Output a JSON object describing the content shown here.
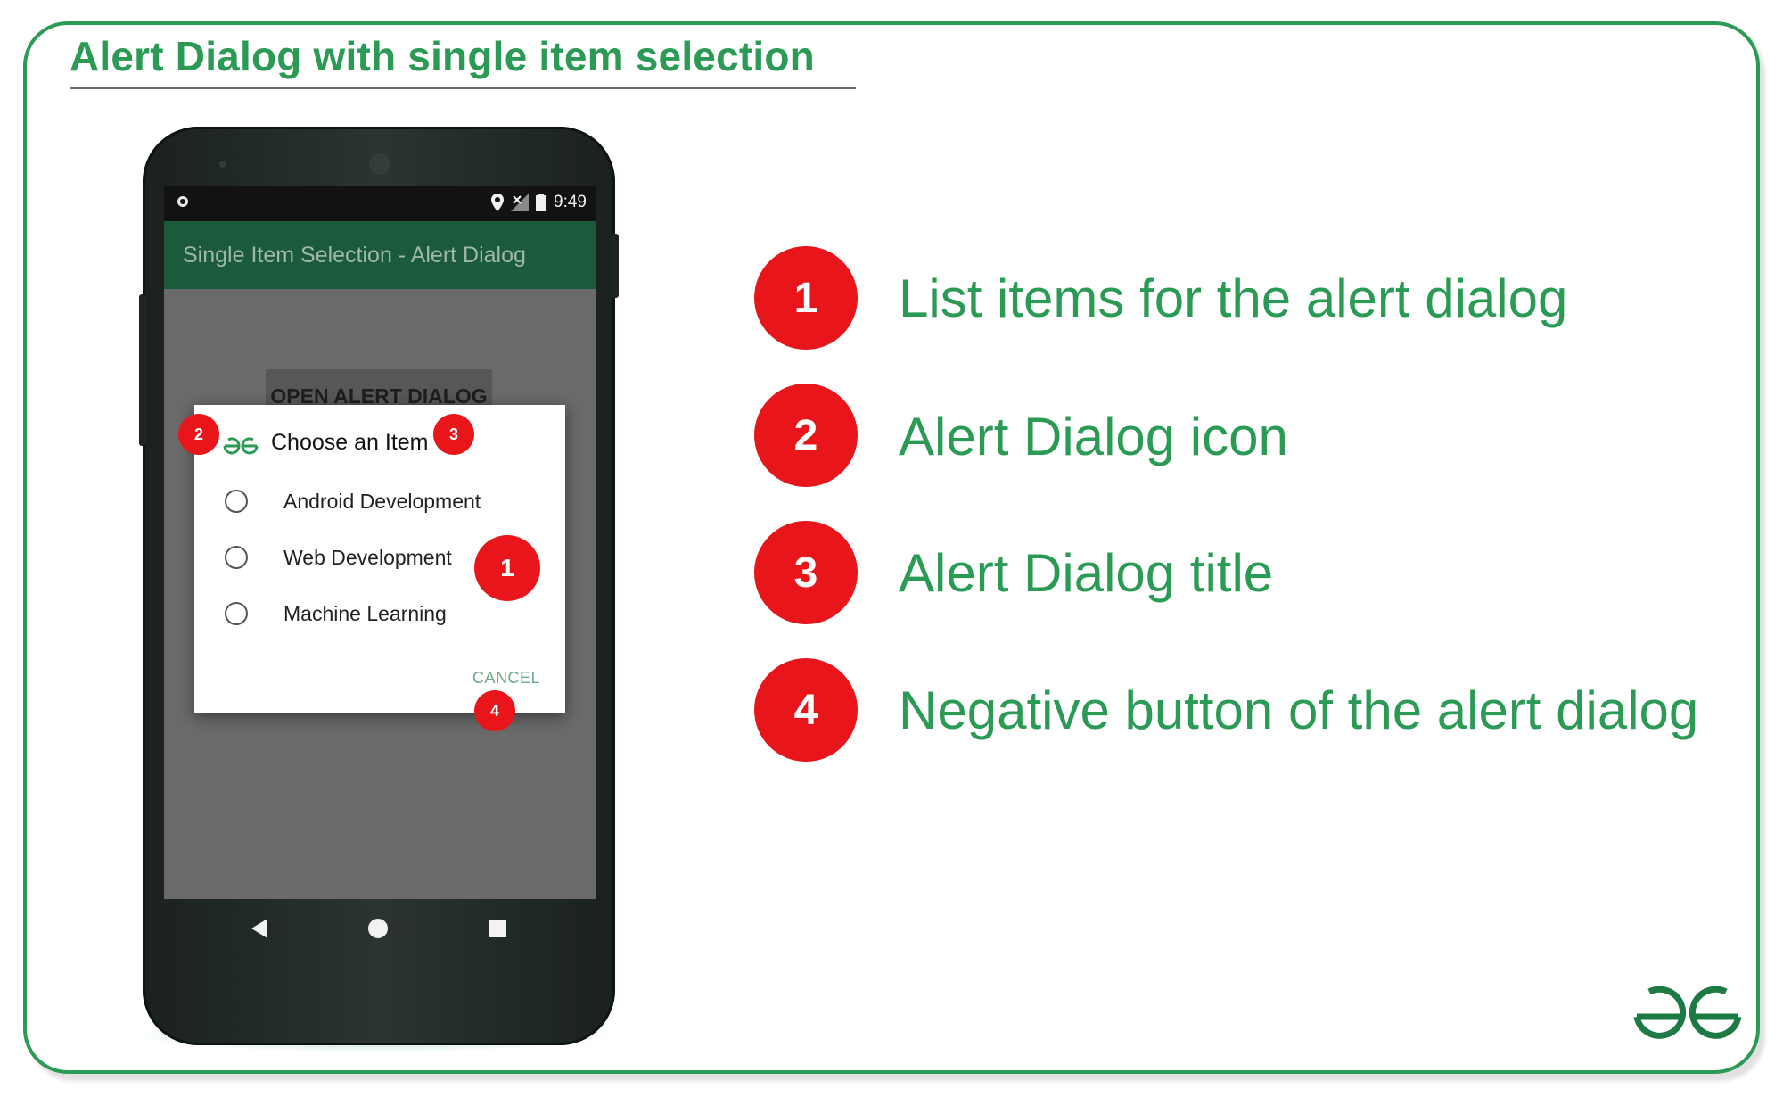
{
  "header": {
    "title": "Alert Dialog with single item selection"
  },
  "colors": {
    "brand_green": "#2a9a55",
    "badge_red": "#e8161b",
    "appbar_green": "#1b5a3a"
  },
  "phone": {
    "status_bar": {
      "time": "9:49",
      "icons": [
        "location-icon",
        "no-signal-icon",
        "battery-icon"
      ]
    },
    "app_bar": {
      "title": "Single Item Selection - Alert Dialog"
    },
    "open_button_label": "OPEN ALERT DIALOG",
    "dialog": {
      "icon": "gfg-logo-icon",
      "title": "Choose an Item",
      "items": [
        "Android Development",
        "Web Development",
        "Machine Learning"
      ],
      "negative_button": "CANCEL"
    },
    "callouts": {
      "items": "1",
      "icon": "2",
      "title": "3",
      "negative": "4"
    },
    "nav_icons": [
      "back-icon",
      "home-icon",
      "recents-icon"
    ]
  },
  "legend": [
    {
      "number": "1",
      "text": "List items for the alert dialog"
    },
    {
      "number": "2",
      "text": "Alert Dialog icon"
    },
    {
      "number": "3",
      "text": "Alert Dialog title"
    },
    {
      "number": "4",
      "text": "Negative button of the alert dialog"
    }
  ],
  "logo": "gfg-logo-icon"
}
